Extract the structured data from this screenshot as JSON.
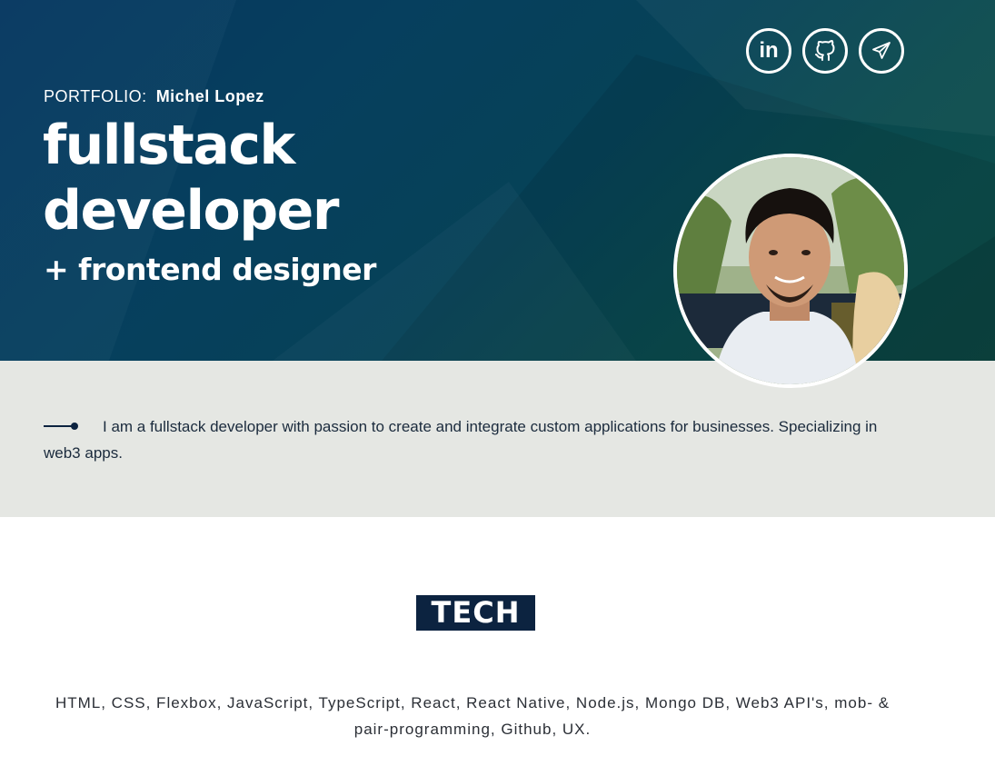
{
  "header": {
    "portfolio_label": "PORTFOLIO:",
    "name": "Michel Lopez",
    "title_line1": "fullstack",
    "title_line2": "developer",
    "subtitle": "+ frontend designer"
  },
  "social": [
    {
      "icon": "linkedin-icon",
      "text": "in"
    },
    {
      "icon": "github-icon"
    },
    {
      "icon": "paper-plane-icon"
    }
  ],
  "intro": {
    "text": "I am a fullstack developer with passion to create and integrate custom applications for businesses. Specializing in web3 apps."
  },
  "tech": {
    "heading": "TECH",
    "text": "HTML, CSS, Flexbox, JavaScript, TypeScript, React, React Native, Node.js, Mongo DB, Web3 API's, mob- & pair-programming, Github, UX."
  },
  "colors": {
    "hero_start": "#05365f",
    "hero_end": "#0f4e48",
    "intro_bg": "#e5e7e3",
    "accent_navy": "#0c2340"
  }
}
